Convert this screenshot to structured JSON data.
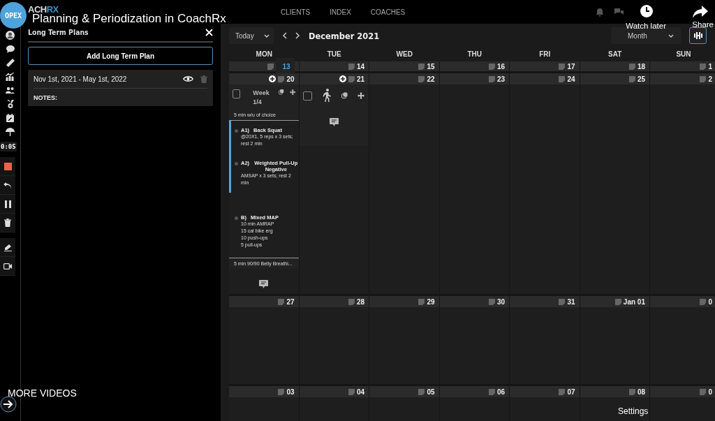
{
  "video": {
    "channel": "OPEX",
    "title": "Planning & Periodization in CoachRx",
    "watch_later": "Watch later",
    "share": "Share",
    "more_videos": "MORE VIDEOS",
    "settings": "Settings"
  },
  "header": {
    "logo_main": "ACH",
    "logo_accent": "RX",
    "nav": [
      "CLIENTS",
      "INDEX",
      "COACHES"
    ]
  },
  "recorder": {
    "timer": "0:05"
  },
  "panel": {
    "title": "Long Term Plans",
    "add_button": "Add Long Term Plan",
    "plans": [
      {
        "dates": "Nov 1st, 2021 - May 1st, 2022",
        "notes_label": "NOTES:"
      }
    ]
  },
  "calendar": {
    "today_button": "Today",
    "title": "December 2021",
    "view": "Month",
    "weekdays": [
      "MON",
      "TUE",
      "WED",
      "THU",
      "FRI",
      "SAT",
      "SUN"
    ],
    "weeks": [
      {
        "days": [
          {
            "date": "13",
            "today": true,
            "addable": false,
            "kind": "empty"
          },
          {
            "date": "14",
            "today": false,
            "addable": false,
            "kind": "empty"
          },
          {
            "date": "15",
            "today": false,
            "addable": false,
            "kind": "empty"
          },
          {
            "date": "16",
            "today": false,
            "addable": false,
            "kind": "empty"
          },
          {
            "date": "17",
            "today": false,
            "addable": false,
            "kind": "empty"
          },
          {
            "date": "18",
            "today": false,
            "addable": false,
            "kind": "empty"
          },
          {
            "date": "1",
            "today": false,
            "addable": false,
            "kind": "empty"
          }
        ]
      },
      {
        "days": [
          {
            "date": "20",
            "today": false,
            "addable": true,
            "kind": "program"
          },
          {
            "date": "21",
            "today": false,
            "addable": true,
            "kind": "rest"
          },
          {
            "date": "22",
            "today": false,
            "addable": false,
            "kind": "empty"
          },
          {
            "date": "23",
            "today": false,
            "addable": false,
            "kind": "empty"
          },
          {
            "date": "24",
            "today": false,
            "addable": false,
            "kind": "empty"
          },
          {
            "date": "25",
            "today": false,
            "addable": false,
            "kind": "empty"
          },
          {
            "date": "2",
            "today": false,
            "addable": false,
            "kind": "empty"
          }
        ]
      },
      {
        "days": [
          {
            "date": "27",
            "today": false,
            "addable": false,
            "kind": "empty"
          },
          {
            "date": "28",
            "today": false,
            "addable": false,
            "kind": "empty"
          },
          {
            "date": "29",
            "today": false,
            "addable": false,
            "kind": "empty"
          },
          {
            "date": "30",
            "today": false,
            "addable": false,
            "kind": "empty"
          },
          {
            "date": "31",
            "today": false,
            "addable": false,
            "kind": "empty"
          },
          {
            "date": "Jan 01",
            "today": false,
            "addable": false,
            "kind": "empty"
          },
          {
            "date": "0",
            "today": false,
            "addable": false,
            "kind": "empty"
          }
        ]
      },
      {
        "days": [
          {
            "date": "03",
            "today": false,
            "addable": false,
            "kind": "empty"
          },
          {
            "date": "04",
            "today": false,
            "addable": false,
            "kind": "empty"
          },
          {
            "date": "05",
            "today": false,
            "addable": false,
            "kind": "empty"
          },
          {
            "date": "06",
            "today": false,
            "addable": false,
            "kind": "empty"
          },
          {
            "date": "07",
            "today": false,
            "addable": false,
            "kind": "empty"
          },
          {
            "date": "08",
            "today": false,
            "addable": false,
            "kind": "empty"
          },
          {
            "date": "0",
            "today": false,
            "addable": false,
            "kind": "empty"
          }
        ]
      }
    ],
    "program": {
      "checked": false,
      "week_label": "Week",
      "week_number": "1/4",
      "warmup": "5 min w/u of choice",
      "exercises": [
        {
          "label": "A1)",
          "name": "Back Squat",
          "grouped": true,
          "lines": [
            "@20X1, 5 reps x 3 sets; rest 2 min"
          ]
        },
        {
          "label": "A2)",
          "name": "Weighted Pull-Up Negative",
          "grouped": true,
          "lines": [
            "AMSAP x 3 sets; rest 2 min"
          ]
        },
        {
          "label": "B)",
          "name": "Mixed MAP",
          "grouped": false,
          "lines": [
            "10 min AMRAP",
            "15 cal bike erg",
            "10 push-ups",
            "5 pull-ups"
          ]
        }
      ],
      "cooldown": "5 min 90/90 Belly Breathi..."
    },
    "rest": {
      "checked": false
    }
  }
}
